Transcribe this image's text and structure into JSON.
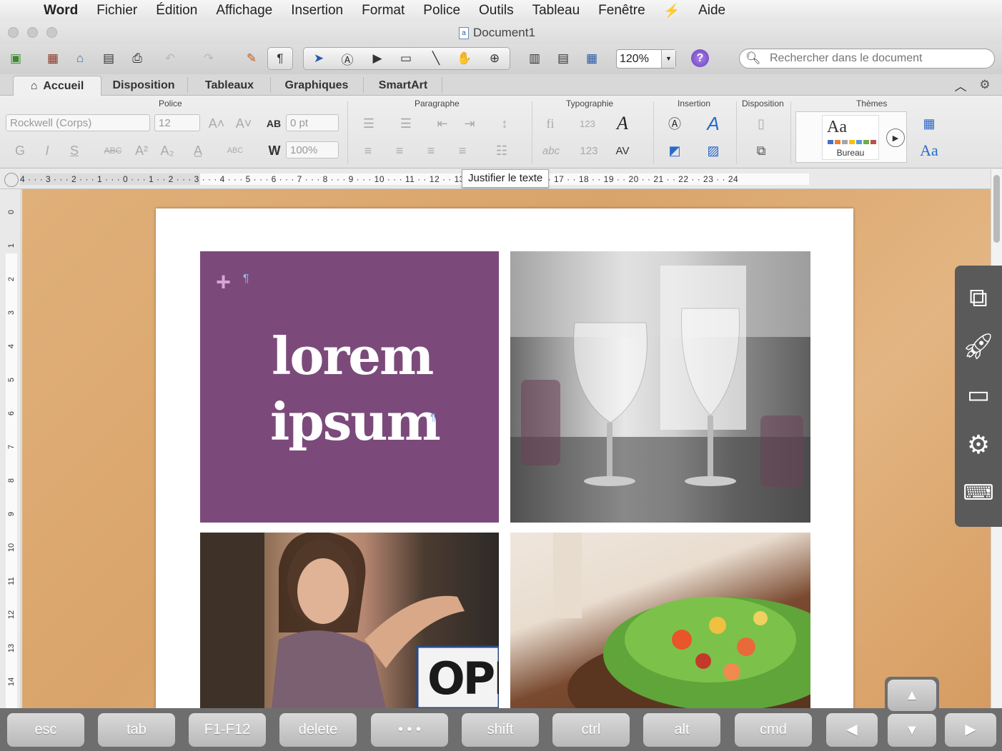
{
  "menubar": {
    "apple": "",
    "app": "Word",
    "items": [
      "Fichier",
      "Édition",
      "Affichage",
      "Insertion",
      "Format",
      "Police",
      "Outils",
      "Tableau",
      "Fenêtre",
      "Aide"
    ]
  },
  "window": {
    "title": "Document1"
  },
  "toolbar": {
    "zoom": "120%",
    "help": "?",
    "search_placeholder": "Rechercher dans le document"
  },
  "tabs": [
    {
      "label": "Accueil",
      "active": true
    },
    {
      "label": "Disposition",
      "active": false
    },
    {
      "label": "Tableaux",
      "active": false
    },
    {
      "label": "Graphiques",
      "active": false
    },
    {
      "label": "SmartArt",
      "active": false
    }
  ],
  "ribbon": {
    "groups": {
      "police": "Police",
      "paragraphe": "Paragraphe",
      "typographie": "Typographie",
      "insertion": "Insertion",
      "disposition": "Disposition",
      "themes": "Thèmes"
    },
    "font_name": "Rockwell (Corps)",
    "font_size": "12",
    "spacing": "0 pt",
    "scale": "100%",
    "theme_sample": "Aa",
    "theme_name": "Bureau",
    "theme_fonts": "Aa"
  },
  "tooltip": "Justifier le texte",
  "ruler": {
    "ticks": "4 · · · 3 · · · 2 · · · 1 · · · 0 · · · 1   · · 2 · · · 3 · · · 4 · · · 5 · · · 6 · · · 7 · · · 8 · · · 9 · · · 10 · · · 11 · · 12 · · 13 · · 14 · · 15 · · 16 · · 17 · · 18 · · 19 · · 20 · · 21 · · 22 · · 23 · · 24",
    "vticks": [
      "0",
      "1",
      "2",
      "3",
      "4",
      "5",
      "6",
      "7",
      "8",
      "9",
      "10",
      "11",
      "12",
      "13",
      "14"
    ]
  },
  "document": {
    "line1": "lorem",
    "line2": "ipsum",
    "sign_text": "OPE",
    "colors": {
      "panel": "#7b4a7a"
    }
  },
  "keyboard": {
    "keys": [
      "esc",
      "tab",
      "F1-F12",
      "delete",
      "• • •",
      "shift",
      "ctrl",
      "alt",
      "cmd"
    ],
    "left": "◀",
    "right": "▶",
    "up": "▲",
    "down": "▼"
  }
}
